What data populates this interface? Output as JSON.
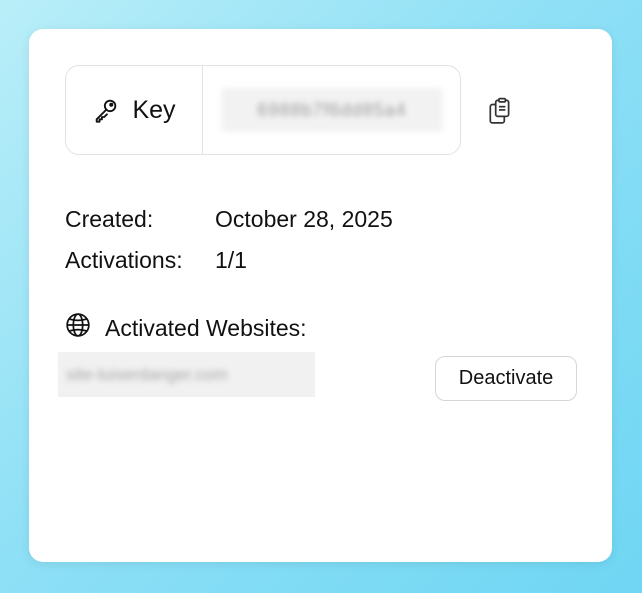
{
  "license": {
    "key_label": "Key",
    "key_value": "6988b7f6dd85a4",
    "key_icon": "key-icon",
    "copy_icon": "copy-icon"
  },
  "details": {
    "created_label": "Created:",
    "created_value": "October 28, 2025",
    "activations_label": "Activations:",
    "activations_value": "1/1"
  },
  "websites": {
    "header_icon": "globe-icon",
    "header_label": "Activated Websites:",
    "items": [
      {
        "domain": "site-luiserdanger.com",
        "action_label": "Deactivate"
      }
    ]
  },
  "colors": {
    "background_start": "#b9eef8",
    "background_end": "#6fd6f3",
    "card": "#ffffff",
    "border": "#e2e2e2"
  }
}
